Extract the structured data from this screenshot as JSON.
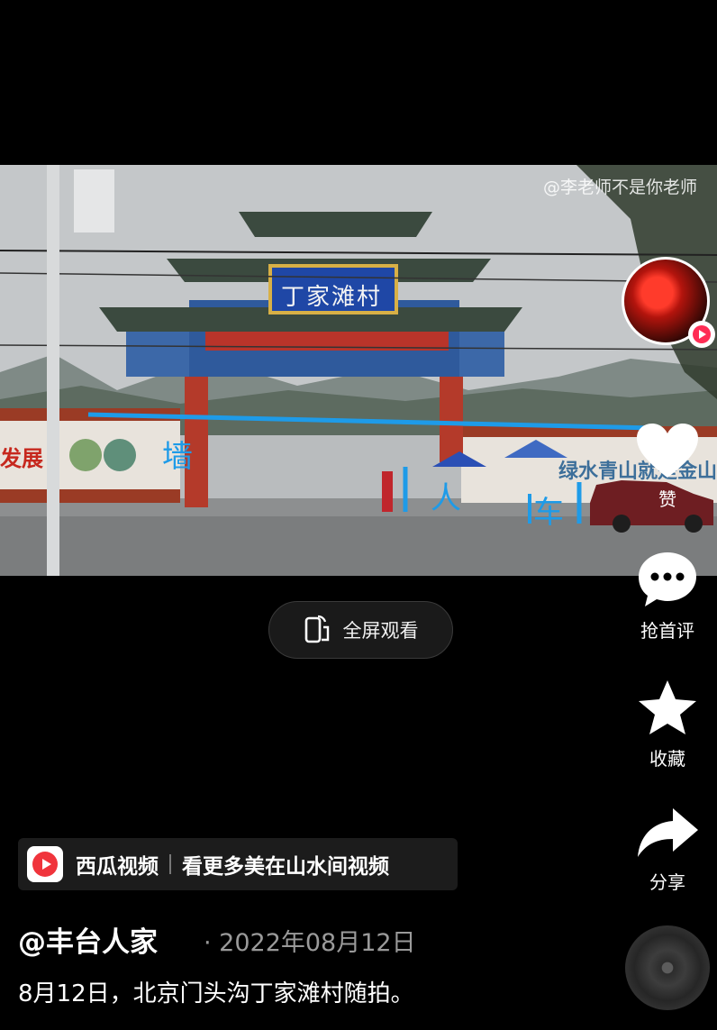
{
  "video": {
    "watermark": "@李老师不是你老师",
    "gate_sign": "丁家滩村",
    "wall_sign_left": "发展",
    "wall_sign_right": "绿水青山就是金山",
    "annotations": {
      "wall": "墙",
      "people": "人",
      "car": "车"
    },
    "annotation_color": "#1e9be8"
  },
  "fullscreen": {
    "label": "全屏观看",
    "icon": "fullscreen-rotate-icon"
  },
  "rail": {
    "like_label": "赞",
    "comment_label": "抢首评",
    "favorite_label": "收藏",
    "share_label": "分享"
  },
  "source": {
    "app_name": "西瓜视频",
    "description": "看更多美在山水间视频",
    "brand_color": "#f0343c"
  },
  "post": {
    "author": "@丰台人家",
    "date": "· 2022年08月12日",
    "caption": "8月12日，北京门头沟丁家滩村随拍。"
  }
}
